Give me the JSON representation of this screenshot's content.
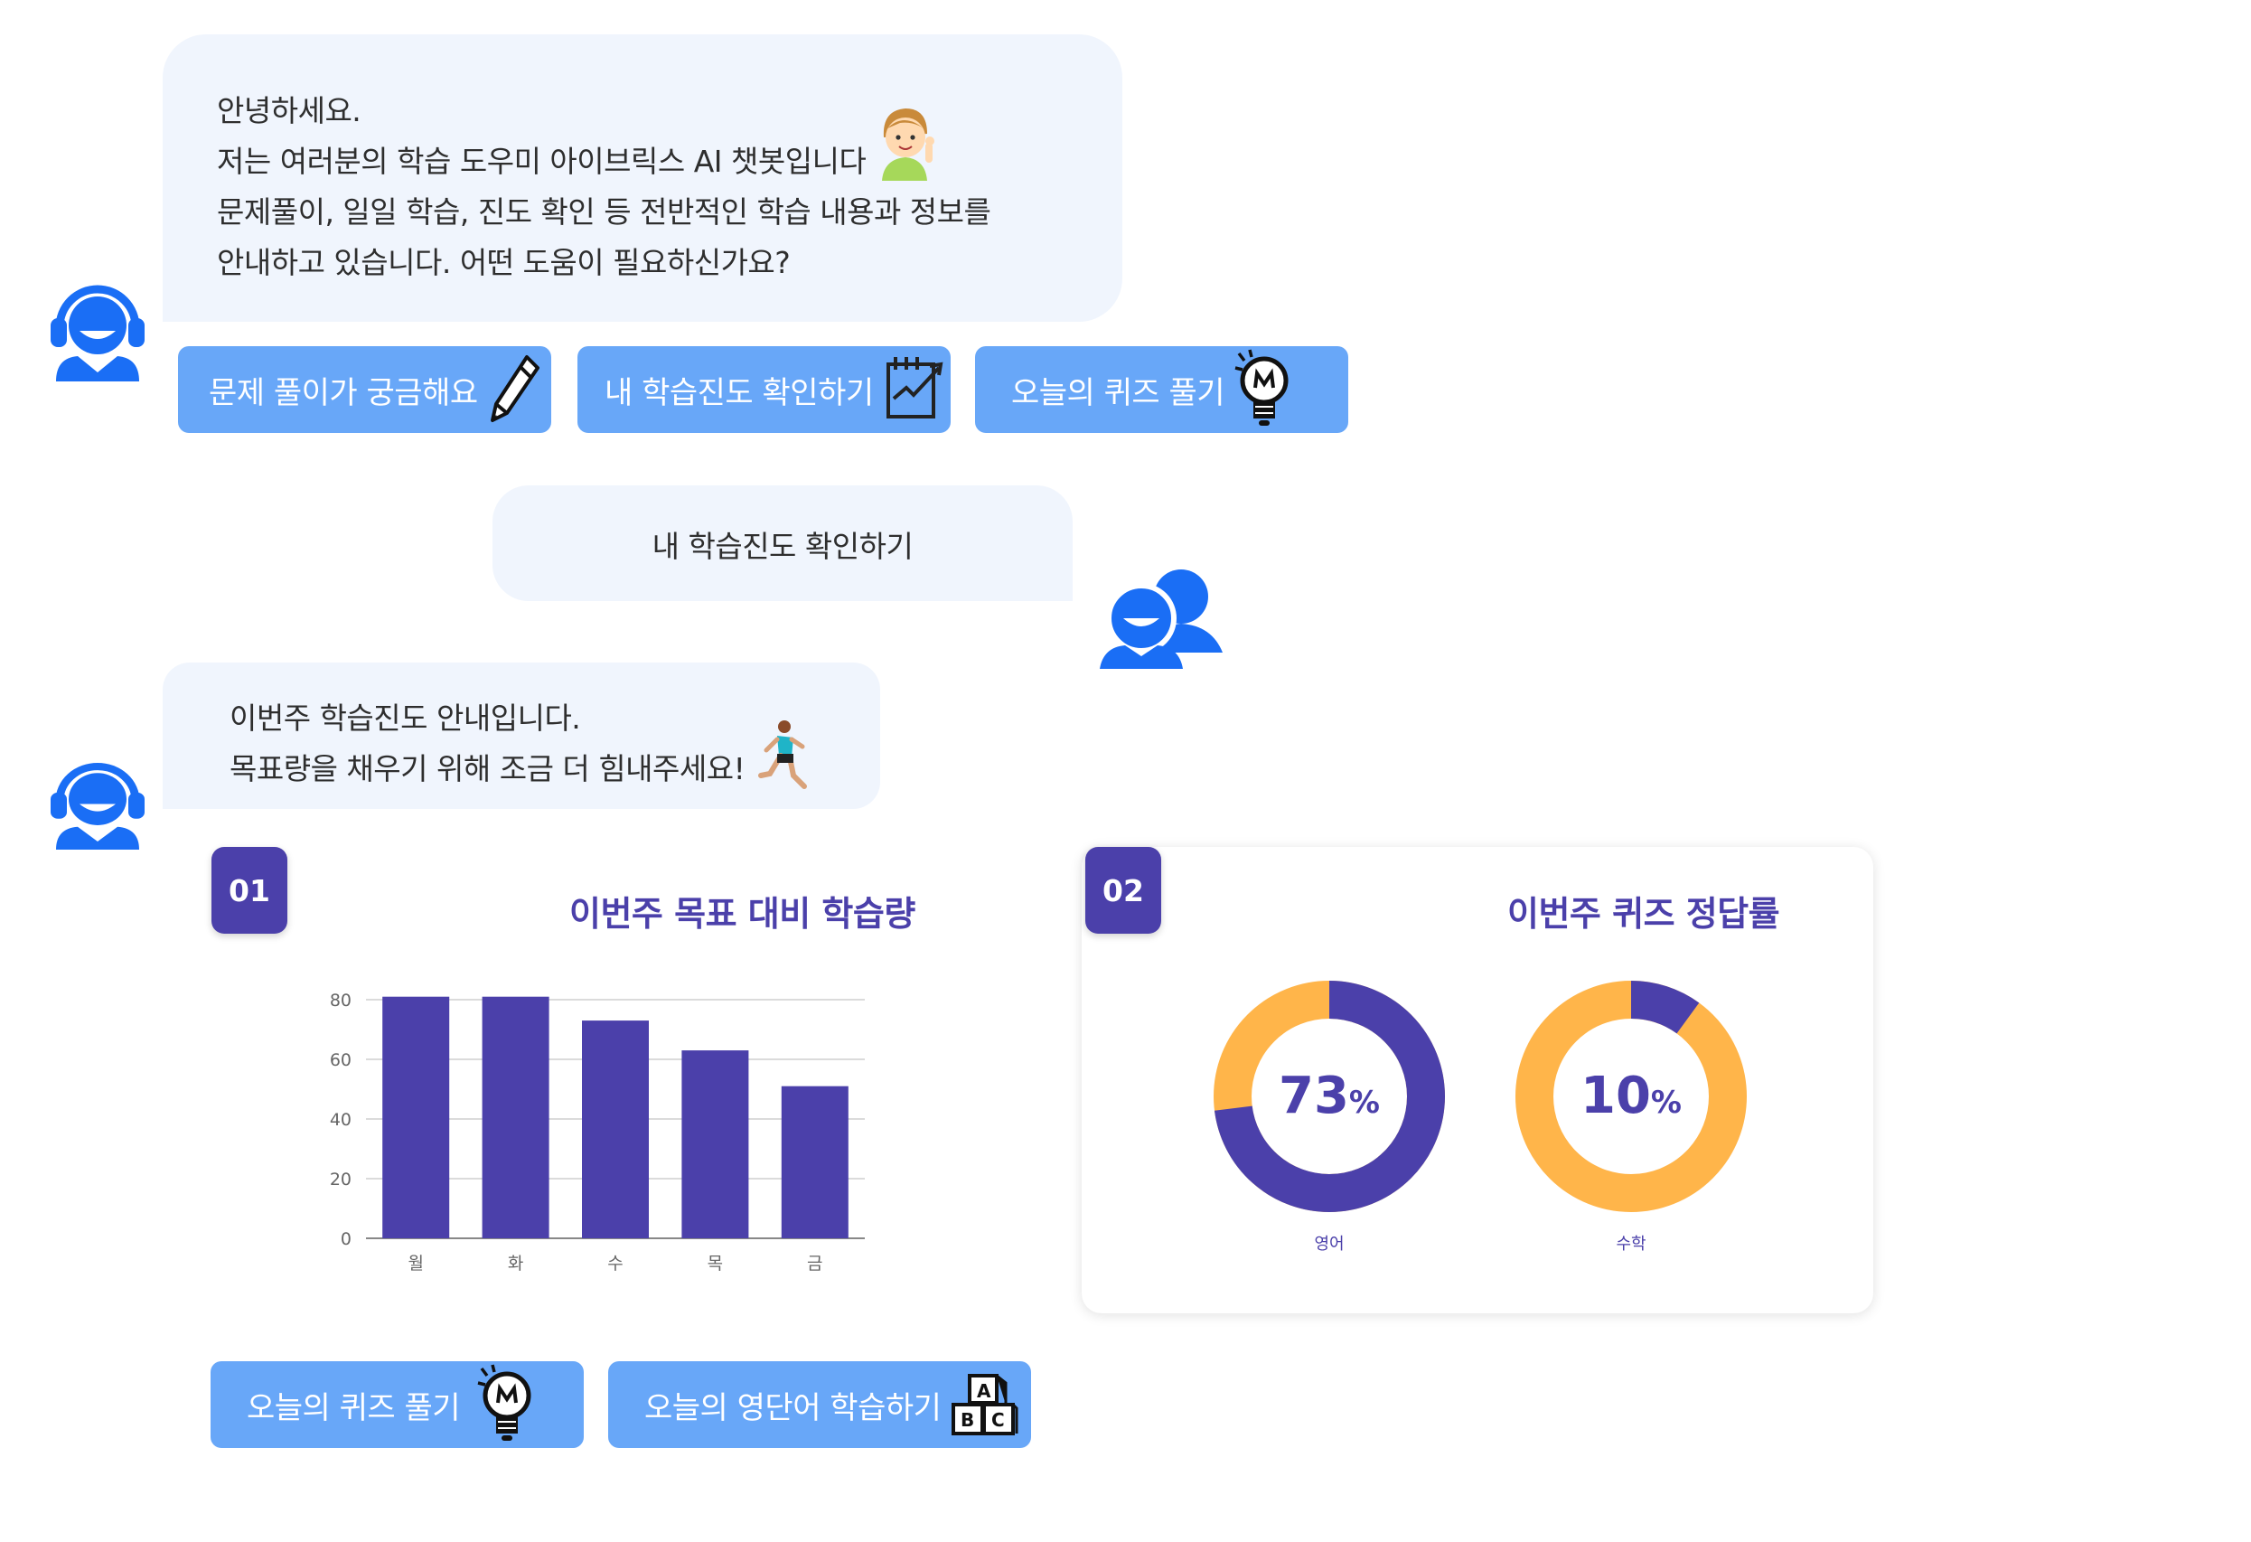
{
  "bot_greeting": {
    "lines": [
      "안녕하세요.",
      "저는 여러분의 학습 도우미 아이브릭스 AI 챗봇입니다",
      "문제풀이, 일일 학습, 진도 확인 등 전반적인 학습 내용과 정보를",
      "안내하고 있습니다. 어떤 도움이 필요하신가요?"
    ]
  },
  "quick_replies_top": [
    {
      "label": "문제 풀이가 궁금해요",
      "icon": "pencil-icon"
    },
    {
      "label": "내 학습진도 확인하기",
      "icon": "progress-chart-icon"
    },
    {
      "label": "오늘의 퀴즈 풀기",
      "icon": "lightbulb-icon"
    }
  ],
  "user_message": {
    "text": "내 학습진도 확인하기"
  },
  "bot_progress": {
    "lines": [
      "이번주 학습진도 안내입니다.",
      "목표량을 채우기 위해 조금 더 힘내주세요!"
    ]
  },
  "panel_weekly": {
    "badge": "01",
    "title": "이번주 목표 대비 학습량"
  },
  "panel_quiz": {
    "badge": "02",
    "title": "이번주 퀴즈 정답률",
    "donuts": [
      {
        "value": "73",
        "unit": "%",
        "label": "영어"
      },
      {
        "value": "10",
        "unit": "%",
        "label": "수학"
      }
    ]
  },
  "quick_replies_bottom": [
    {
      "label": "오늘의 퀴즈 풀기",
      "icon": "lightbulb-icon"
    },
    {
      "label": "오늘의 영단어 학습하기",
      "icon": "abc-blocks-icon"
    }
  ],
  "colors": {
    "accent": "#4b40aa",
    "orange": "#ffb54a",
    "button": "#68a7f8",
    "bubble": "#f0f5fd",
    "avatar": "#1a6ef5"
  },
  "chart_data": [
    {
      "type": "bar",
      "title": "이번주 목표 대비 학습량",
      "categories": [
        "월",
        "화",
        "수",
        "목",
        "금"
      ],
      "values": [
        81,
        81,
        73,
        63,
        51
      ],
      "yticks": [
        "0",
        "20",
        "40",
        "60",
        "80"
      ],
      "ylim": [
        0,
        80
      ],
      "grid": true
    },
    {
      "type": "pie",
      "title": "이번주 퀴즈 정답률",
      "series": [
        {
          "name": "영어",
          "values": [
            73,
            27
          ]
        },
        {
          "name": "수학",
          "values": [
            10,
            90
          ]
        }
      ]
    }
  ]
}
